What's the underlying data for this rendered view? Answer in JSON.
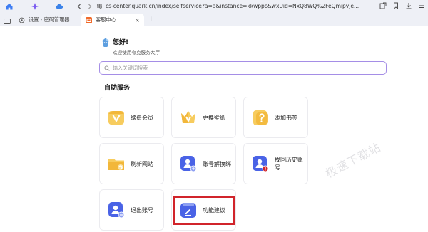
{
  "browser": {
    "url": "cs-center.quark.cn/index/selfservice?a=a&instance=kkwppc&wxUid=NxQ8WQ%2FeQmipvJe...",
    "tabs": [
      {
        "label": "设置 - 密码管理器",
        "active": false
      },
      {
        "label": "客服中心",
        "active": true
      }
    ],
    "new_tab_symbol": "+",
    "close_symbol": "×"
  },
  "greeting": {
    "title": "您好!",
    "subtitle": "欢迎使用夸克服务大厅"
  },
  "search": {
    "placeholder": "输入关键词搜索"
  },
  "section": {
    "title": "自助服务"
  },
  "services": [
    {
      "label": "续费会员",
      "icon": "vip-card-icon"
    },
    {
      "label": "更换壁纸",
      "icon": "crown-icon"
    },
    {
      "label": "添加书签",
      "icon": "bookmark-question-icon"
    },
    {
      "label": "刷新网站",
      "icon": "refresh-folder-icon"
    },
    {
      "label": "账号解换绑",
      "icon": "account-unbind-icon"
    },
    {
      "label": "找回历史账号",
      "icon": "account-recover-icon"
    },
    {
      "label": "退出账号",
      "icon": "account-logout-icon"
    },
    {
      "label": "功能建议",
      "icon": "feedback-edit-icon"
    }
  ],
  "watermark": "极速下载站",
  "colors": {
    "search_border": "#a58ee6",
    "highlight_box": "#d1242b",
    "gold": "#f2b73a",
    "blue": "#4a63e6"
  }
}
